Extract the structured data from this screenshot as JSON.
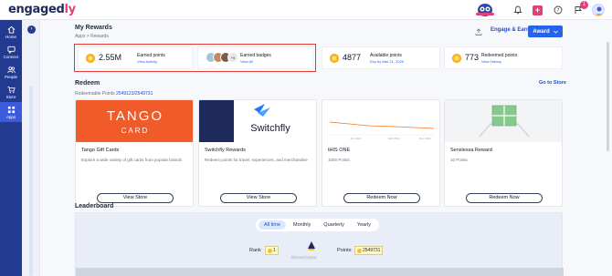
{
  "app": {
    "logo_main": "engaged",
    "logo_accent": "ly",
    "notification_count": "1"
  },
  "sidebar": {
    "items": [
      {
        "label": "Home",
        "icon": "home-icon"
      },
      {
        "label": "Connect",
        "icon": "chat-icon"
      },
      {
        "label": "People",
        "icon": "people-icon"
      },
      {
        "label": "Store",
        "icon": "cart-icon"
      },
      {
        "label": "Apps",
        "icon": "apps-icon",
        "active": true
      }
    ],
    "secondary_button": "›"
  },
  "header": {
    "title": "My Rewards",
    "breadcrumb": "Apps  >  Rewards",
    "earn_label": "Engage & Earn",
    "award_label": "Award"
  },
  "stats": {
    "earned_value": "2.55M",
    "earned_label": "Earned points",
    "earned_link": "View Activity",
    "badges_label": "Earned badges",
    "badges_link": "View All",
    "badges_more": "+9",
    "available_value": "4877",
    "available_label": "Available points",
    "available_link": "Exp by Mar 21, 2026",
    "redeemed_value": "773",
    "redeemed_label": "Redeemed points",
    "redeemed_link": "View History"
  },
  "redeem": {
    "title": "Redeem",
    "goto_store": "Go to Store",
    "redeemable_label": "Redeemable Points",
    "redeemable_value": "2549123/2549731",
    "cards": [
      {
        "title": "Tango Gift Cards",
        "desc": "Explore a wide variety of gift cards from popular brands",
        "button": "View Store",
        "brand_line1": "TANGO",
        "brand_line2": "CARD"
      },
      {
        "title": "Switchfly Rewards",
        "desc": "Redeem points for travel, experiences, and merchandise",
        "button": "View Store",
        "brand": "Switchfly"
      },
      {
        "title": "tHIS ONE",
        "desc": "1000 Points",
        "button": "Redeem Now",
        "chart_labels": [
          "Jun 2024",
          "Mar 2024",
          "Dec 2024"
        ]
      },
      {
        "title": "Senslessa Reward",
        "desc": "10 Points",
        "button": "Redeem Now"
      }
    ]
  },
  "leaderboard": {
    "title": "Leaderboard",
    "periods": [
      "All time",
      "Monthly",
      "Quarterly",
      "Yearly"
    ],
    "active_period": "All time",
    "rank_label": "Rank",
    "rank_value": "1",
    "points_label": "Points:",
    "points_value": "2549731",
    "leader_name": "Blurred Name"
  },
  "colors": {
    "sidebar": "#223a8f",
    "accent": "#2563eb",
    "highlight": "#e53935",
    "brand_pink": "#e0407b",
    "tango": "#f15a29"
  }
}
